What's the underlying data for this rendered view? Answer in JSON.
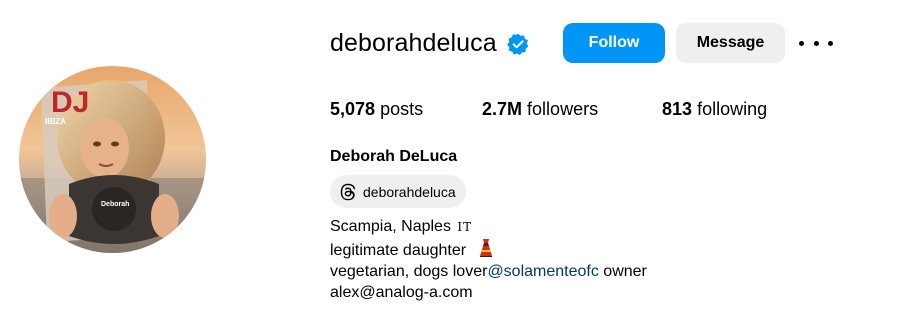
{
  "profile": {
    "username": "deborahdeluca",
    "verified_icon": "verified-badge-icon",
    "full_name": "Deborah DeLuca",
    "avatar_magazine_logo": "DJ",
    "avatar_magazine_text": "IBIZA",
    "avatar_magazine_name": "Deborah"
  },
  "actions": {
    "follow_label": "Follow",
    "message_label": "Message",
    "more_icon": "more-options-icon"
  },
  "stats": {
    "posts_count": "5,078",
    "posts_label": "posts",
    "followers_count": "2.7M",
    "followers_label": "followers",
    "following_count": "813",
    "following_label": "following"
  },
  "threads": {
    "icon": "threads-icon",
    "handle": "deborahdeluca"
  },
  "bio": {
    "line1_text": "Scampia, Naples ",
    "line1_flag": "IT",
    "line2_text": "legitimate daughter",
    "line2_emoji": "dress-emoji",
    "line3_text": "vegetarian, dogs lover",
    "line3_mention": "@solamenteofc",
    "line3_suffix": " owner",
    "line4_text": "alex@analog-a.com"
  },
  "colors": {
    "follow_button": "#0095f6",
    "message_button": "#efefef",
    "verified_badge": "#0095f6",
    "mention_link": "#00376b"
  }
}
